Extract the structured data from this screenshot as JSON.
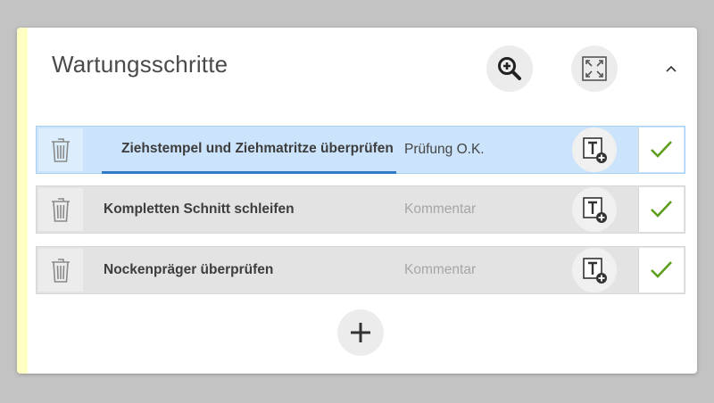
{
  "panel": {
    "title": "Wartungsschritte"
  },
  "icons": {
    "zoom": "zoom-in-icon",
    "expand": "fullscreen-icon",
    "collapse": "chevron-up-icon",
    "delete": "trash-icon",
    "add_text": "add-text-icon",
    "confirm": "checkmark-icon",
    "add_step": "plus-icon"
  },
  "colors": {
    "accent": "#ffffc4",
    "active_row": "#cce4fb",
    "active_underline": "#2e7bc4",
    "check": "#5e9e1e"
  },
  "steps": [
    {
      "label": "Ziehstempel und Ziehmatritze überprüfen",
      "comment": "Prüfung O.K.",
      "comment_placeholder": "Kommentar",
      "active": true
    },
    {
      "label": "Kompletten Schnitt schleifen",
      "comment": "",
      "comment_placeholder": "Kommentar",
      "active": false
    },
    {
      "label": "Nockenpräger überprüfen",
      "comment": "",
      "comment_placeholder": "Kommentar",
      "active": false
    }
  ]
}
